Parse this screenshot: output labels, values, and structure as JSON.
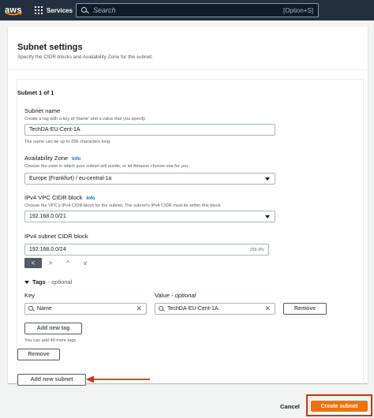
{
  "nav": {
    "logo_text": "aws",
    "services_label": "Services",
    "search_placeholder": "Search",
    "search_shortcut": "[Option+S]"
  },
  "panel": {
    "title": "Subnet settings",
    "description": "Specify the CIDR blocks and Availability Zone for the subnet."
  },
  "subnet": {
    "header": "Subnet 1 of 1",
    "name": {
      "label": "Subnet name",
      "description": "Create a tag with a key of 'Name' and a value that you specify.",
      "value": "TechDA-EU-Cent-1A",
      "hint": "The name can be up to 256 characters long."
    },
    "availability_zone": {
      "label": "Availability Zone",
      "info": "Info",
      "description": "Choose the zone in which your subnet will reside, or let Amazon choose one for you.",
      "value": "Europe (Frankfurt) / eu-central-1a"
    },
    "vpc_cidr": {
      "label": "IPv4 VPC CIDR block",
      "info": "Info",
      "description": "Choose the VPC's IPv4 CIDR block for the subnet. The subnet's IPv4 CIDR must lie within this block.",
      "value": "192.168.0.0/21"
    },
    "subnet_cidr": {
      "label": "IPv4 subnet CIDR block",
      "value": "192.168.0.0/24",
      "ips": "256 IPs"
    },
    "stepper": {
      "left": "<",
      "right": ">",
      "up": "^",
      "down": "v"
    },
    "tags": {
      "label": "Tags",
      "optional": "- optional",
      "key_label": "Key",
      "value_label": "Value",
      "value_optional": "- optional",
      "key_value": "Name",
      "value_value": "TechDA-EU-Cent-1A",
      "remove_label": "Remove",
      "add_tag_label": "Add new tag",
      "remaining": "You can add 49 more tags."
    },
    "remove_subnet_label": "Remove"
  },
  "add_subnet_label": "Add new subnet",
  "footer": {
    "cancel_label": "Cancel",
    "create_label": "Create subnet"
  },
  "colors": {
    "nav_bg": "#232f3e",
    "primary": "#ec7211",
    "highlight": "#d13212",
    "link": "#0073bb"
  }
}
